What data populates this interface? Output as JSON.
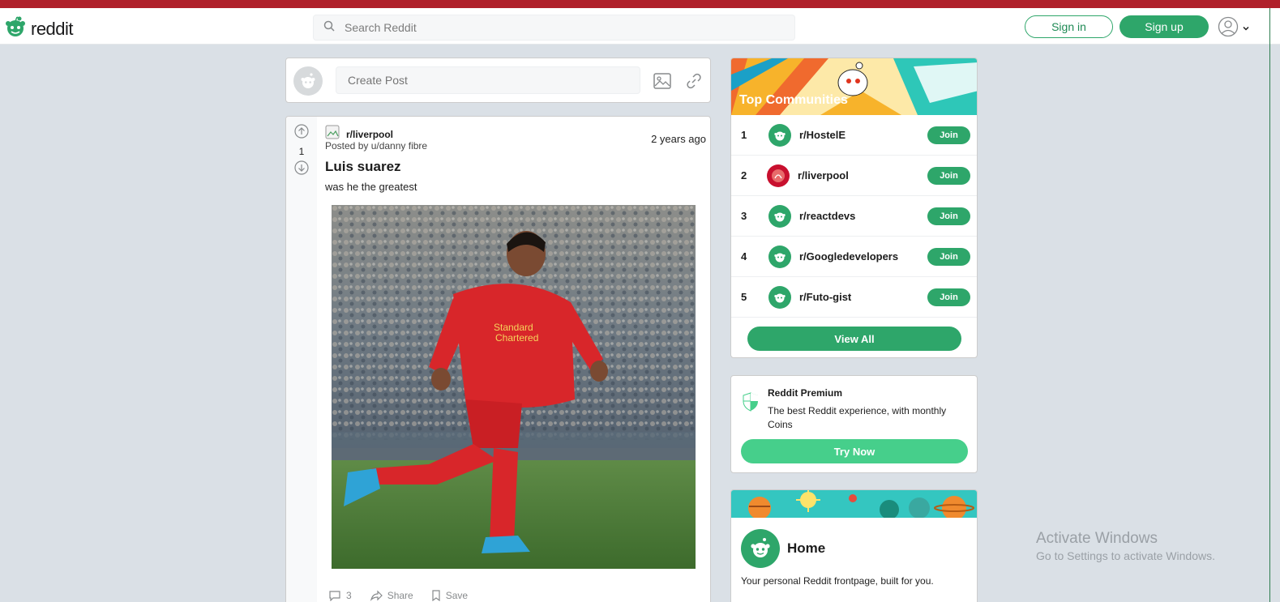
{
  "header": {
    "logo_text": "reddit",
    "search_placeholder": "Search Reddit",
    "signin_label": "Sign in",
    "signup_label": "Sign up",
    "accent": "#2ea66a"
  },
  "create_post": {
    "placeholder": "Create Post"
  },
  "post": {
    "votes": "1",
    "subreddit": "r/liverpool",
    "posted_by": "Posted by u/danny fibre",
    "time": "2 years ago",
    "title": "Luis suarez",
    "text": "was he the greatest",
    "comments_count": "3",
    "share_label": "Share",
    "save_label": "Save"
  },
  "top_communities": {
    "title": "Top Communities",
    "items": [
      {
        "rank": "1",
        "name": "r/HostelE",
        "join": "Join"
      },
      {
        "rank": "2",
        "name": "r/liverpool",
        "join": "Join"
      },
      {
        "rank": "3",
        "name": "r/reactdevs",
        "join": "Join"
      },
      {
        "rank": "4",
        "name": "r/Googledevelopers",
        "join": "Join"
      },
      {
        "rank": "5",
        "name": "r/Futo-gist",
        "join": "Join"
      }
    ],
    "view_all": "View All"
  },
  "premium": {
    "title": "Reddit Premium",
    "description": "The best Reddit experience, with monthly Coins",
    "button": "Try Now"
  },
  "home": {
    "title": "Home",
    "description": "Your personal Reddit frontpage, built for you."
  },
  "watermark": {
    "title": "Activate Windows",
    "subtitle": "Go to Settings to activate Windows."
  }
}
